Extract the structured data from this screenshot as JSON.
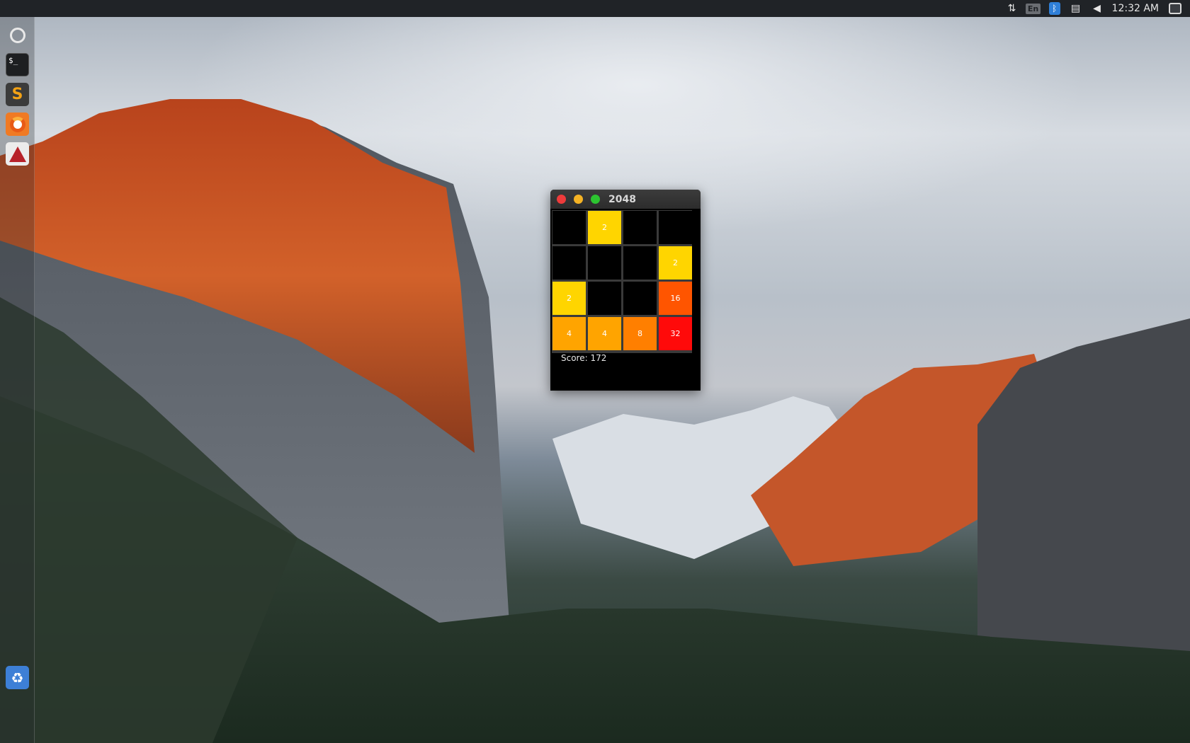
{
  "top_panel": {
    "indicators": [
      {
        "icon": "transfer-arrows-icon"
      },
      {
        "icon": "keyboard-layout-icon",
        "label": "En"
      },
      {
        "icon": "bluetooth-icon"
      },
      {
        "icon": "clipboard-icon"
      },
      {
        "icon": "volume-icon"
      }
    ],
    "clock": "12:32 AM",
    "session_icon": "session-menu-icon"
  },
  "launcher": {
    "items": [
      {
        "name": "ubuntu-dash",
        "icon": "ubuntu-logo-icon"
      },
      {
        "name": "terminal",
        "icon": "terminal-icon",
        "glyph": "$_"
      },
      {
        "name": "sublime-text",
        "icon": "sublime-text-icon",
        "glyph": "S"
      },
      {
        "name": "firefox",
        "icon": "firefox-icon"
      },
      {
        "name": "java-app",
        "icon": "java-icon"
      },
      {
        "name": "trash",
        "icon": "trash-icon"
      }
    ]
  },
  "window": {
    "title": "2048",
    "colors": {
      "empty": "#000000",
      "2": "#ffd500",
      "4": "#ffa400",
      "8": "#ff7f00",
      "16": "#ff5500",
      "32": "#ff0a0a"
    },
    "grid": [
      [
        "",
        "2",
        "",
        ""
      ],
      [
        "",
        "",
        "",
        "2"
      ],
      [
        "2",
        "",
        "",
        "16"
      ],
      [
        "4",
        "4",
        "8",
        "32"
      ]
    ],
    "score_text": "Score: 172"
  }
}
